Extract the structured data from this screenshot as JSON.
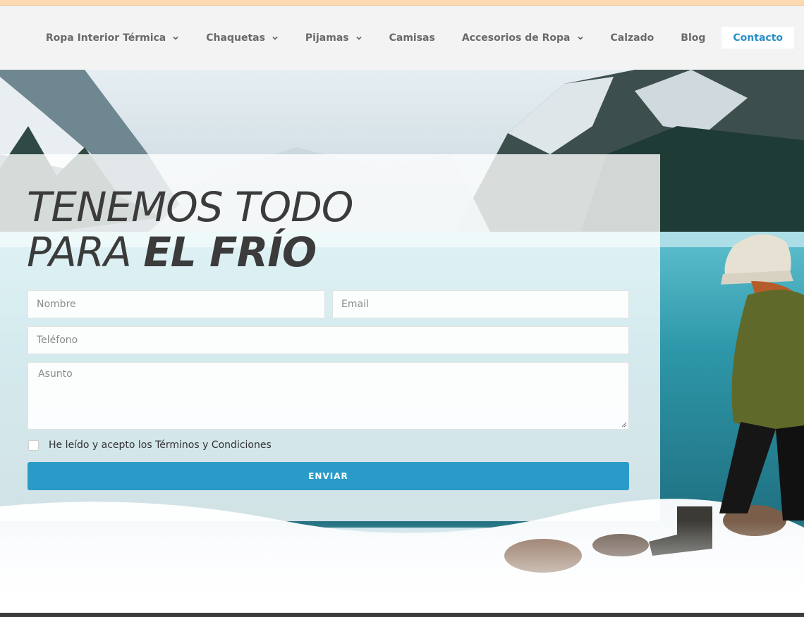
{
  "nav": {
    "items": [
      {
        "label": "Ropa Interior Térmica",
        "has_dropdown": true
      },
      {
        "label": "Chaquetas",
        "has_dropdown": true
      },
      {
        "label": "Pijamas",
        "has_dropdown": true
      },
      {
        "label": "Camisas",
        "has_dropdown": false
      },
      {
        "label": "Accesorios de Ropa",
        "has_dropdown": true
      },
      {
        "label": "Calzado",
        "has_dropdown": false
      },
      {
        "label": "Blog",
        "has_dropdown": false
      },
      {
        "label": "Contacto",
        "has_dropdown": false,
        "active": true
      }
    ],
    "chevron_icon": "chevron-down-icon"
  },
  "hero": {
    "headline_line1": "TENEMOS TODO",
    "headline_line2_light": "PARA ",
    "headline_line2_bold": "EL FRÍO"
  },
  "form": {
    "nombre_placeholder": "Nombre",
    "email_placeholder": "Email",
    "telefono_placeholder": "Teléfono",
    "asunto_placeholder": "Asunto",
    "terms_label": "He leído y acepto los Términos y Condiciones",
    "terms_checked": false,
    "submit_label": "ENVIAR"
  },
  "colors": {
    "accent": "#2a9bc9",
    "active_nav_text": "#2a8fc7",
    "top_strip": "#fcd9b3"
  }
}
